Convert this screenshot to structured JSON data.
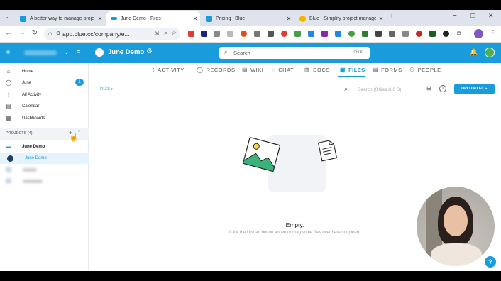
{
  "browser": {
    "tabs": [
      {
        "title": "A better way to manage proje",
        "favicon_color": "#1a9bdc"
      },
      {
        "title": "June Demo · Files",
        "favicon_color": "#1a9bdc",
        "active": true
      },
      {
        "title": "Pricing | Blue",
        "favicon_color": "#1a9bdc"
      },
      {
        "title": "Blue - Simplify project manage",
        "favicon_color": "#f5b400"
      }
    ],
    "new_tab": "+",
    "url": "app.blue.cc/company/e..."
  },
  "app": {
    "project_name": "June Demo",
    "search_placeholder": "Search",
    "search_shortcut": "Ctrl K",
    "accent_color": "#1a9bdc"
  },
  "sidebar": {
    "items": [
      {
        "label": "Home",
        "icon": "home-icon"
      },
      {
        "label": "June",
        "icon": "check-circle-icon",
        "badge": "1"
      },
      {
        "label": "All Activity",
        "icon": "activity-icon"
      },
      {
        "label": "Calendar",
        "icon": "calendar-icon"
      },
      {
        "label": "Dashboards",
        "icon": "dashboard-icon"
      }
    ],
    "projects_header": "PROJECTS (4)",
    "projects": [
      {
        "label": "June Demo",
        "icon": "folder-icon"
      },
      {
        "label": "June Demo",
        "icon": "project-avatar-icon",
        "selected": true
      }
    ]
  },
  "main": {
    "tabs": [
      {
        "label": "ACTIVITY",
        "icon": "activity-icon"
      },
      {
        "label": "RECORDS",
        "icon": "check-circle-icon"
      },
      {
        "label": "WIKI",
        "icon": "doc-icon"
      },
      {
        "label": "CHAT",
        "icon": "chat-icon"
      },
      {
        "label": "DOCS",
        "icon": "docs-icon"
      },
      {
        "label": "FILES",
        "icon": "files-icon",
        "active": true
      },
      {
        "label": "FORMS",
        "icon": "forms-icon"
      },
      {
        "label": "PEOPLE",
        "icon": "people-icon"
      }
    ],
    "files_dropdown": "FILES ▾",
    "files_search_placeholder": "Search (0 files & 0 B)",
    "upload_button": "UPLOAD FILE",
    "empty_title": "Empty.",
    "empty_subtitle": "Click the Upload button above or drag some files over here to upload."
  },
  "help_button": "?"
}
